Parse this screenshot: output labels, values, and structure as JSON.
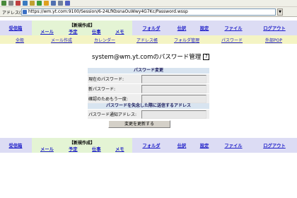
{
  "browser": {
    "address_label": "アドレス(D)",
    "url": "https://wm.yt.com:9100/Session/6-24LfKbsnaOuWwy4G7Kc/Password.wssp",
    "dropdown_glyph": "▼"
  },
  "nav": {
    "inbox": "受信箱",
    "new_title": "【新規作成】",
    "new_mail": "メール",
    "new_schedule": "予定",
    "new_task": "仕事",
    "new_memo": "メモ",
    "folder": "フォルダ",
    "tasks": "仕訳",
    "settings": "設定",
    "files": "ファイル",
    "logout": "ログアウト"
  },
  "subnav": {
    "general": "全般",
    "mail_compose": "メール作成",
    "calendar": "カレンダー",
    "address_book": "アドレス帳",
    "folder_manage": "フォルダ管理",
    "password": "パスワード",
    "external_pop": "外部POP"
  },
  "title": {
    "text": "system@wm.yt.comのパスワード管理",
    "help": "?"
  },
  "form": {
    "section_change": "パスワード変更",
    "current_password": "現在のパスワード:",
    "new_password": "新パスワード:",
    "confirm_password": "確認のためもう一度:",
    "section_recovery": "パスワードを失念した際に送信するアドレス",
    "recovery_address": "パスワード通知アドレス:",
    "submit": "変更を更新する"
  },
  "colors": {
    "nav_bg": "#dcdcf4",
    "nav_new_bg": "#e4f4d4",
    "subnav_bg": "#f4f4c4",
    "link": "#1e1ec8",
    "section_bg": "#d8e4f0"
  }
}
